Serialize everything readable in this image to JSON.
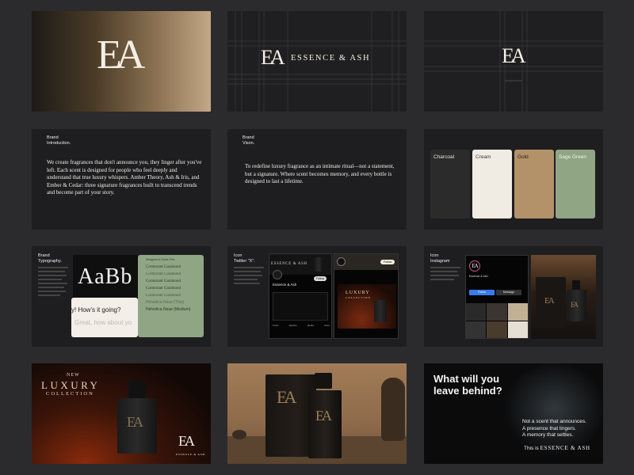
{
  "brand": {
    "monogram": "EA",
    "name": "ESSENCE & ASH"
  },
  "slides": {
    "intro": {
      "heading_line1": "Brand",
      "heading_line2": "Introduction.",
      "body": "We create fragrances that don't announce you, they linger after you've left. Each scent is designed for people who feel deeply and understand that true luxury whispers. Amber Theory, Ash & Iris, and Ember & Cedar: three signature fragrances built to transcend trends and become part of your story."
    },
    "vision": {
      "heading_line1": "Brand",
      "heading_line2": "Vison.",
      "body": "To redefine luxury fragrance as an intimate ritual—not a statement, but a signature. Where scent becomes memory, and every bottle is designed to last a lifetime."
    },
    "colors": {
      "swatches": [
        {
          "name": "Charcoal",
          "color": "#2b2b2b",
          "text": "#e6e6e6"
        },
        {
          "name": "Cream",
          "color": "#f1ece3",
          "text": "#3a3a3a"
        },
        {
          "name": "Gold",
          "color": "#b3926a",
          "text": "#2a2015"
        },
        {
          "name": "Sage Green",
          "color": "#8fa583",
          "text": "#f4f4ee"
        }
      ]
    },
    "typography": {
      "heading_line1": "Brand",
      "heading_line2": "Typography.",
      "specimen": "AaBb",
      "chat_line1": "y! How's it going?",
      "chat_line2": "Great, how about yo",
      "panel_label": "Designed in Gorlie Fine",
      "fonts": [
        "Cormorant Garamond",
        "Cormorant Garamond",
        "Cormorant Garamond",
        "Cormorant Garamond",
        "Cormorant Garamond",
        "Helvetica Neue (Thin)",
        "Helvetica Neue (Medium)"
      ]
    },
    "twitter": {
      "heading_line1": "Icon",
      "heading_line2": "Twitter \"X\".",
      "profile_name": "Essence & Ash",
      "tabs": [
        "Posts",
        "Replies",
        "Media",
        "Likes"
      ],
      "follow": "Follow",
      "promo_line1": "LUXURY",
      "promo_line2": "COLLECTION"
    },
    "instagram": {
      "heading_line1": "Icon",
      "heading_line2": "Instagram",
      "follow": "Follow",
      "message": "Message",
      "profile_name": "Essence & Ash"
    },
    "luxury": {
      "line1": "NEW",
      "line2": "LUXURY",
      "line3": "COLLECTION",
      "footer": "ESSENCE & ASH"
    },
    "closing": {
      "headline_line1": "What will you",
      "headline_line2": "leave behind?",
      "tag1": "Not a scent that announces.",
      "tag2": "A presence that lingers.",
      "tag3": "A memory that settles.",
      "sign_prefix": "This is",
      "sign_brand": "ESSENCE & ASH"
    }
  }
}
